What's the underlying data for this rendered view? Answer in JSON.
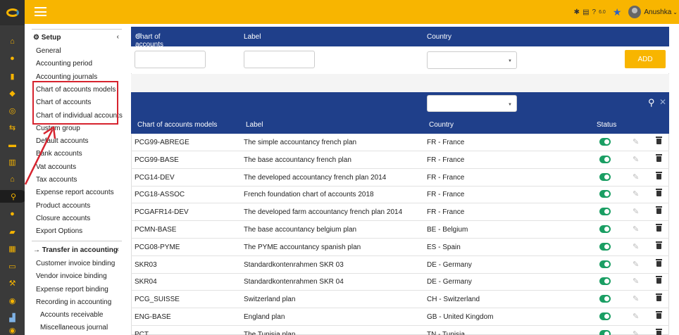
{
  "topbar": {
    "version": "6.0",
    "username": "Anushka"
  },
  "icons": {
    "rail": [
      "home-icon",
      "user-icon",
      "book-icon",
      "box-icon",
      "coins-icon",
      "flow-icon",
      "briefcase-icon",
      "stack-icon",
      "bank-icon",
      "search-icon",
      "person-icon",
      "folder-icon",
      "calendar-icon",
      "card-icon",
      "wrench-icon",
      "globe-icon",
      "chart-icon",
      "php-icon"
    ],
    "accent": "#f8b500",
    "header_blue": "#1f3f8a",
    "status_green": "#1a9e63",
    "highlight_red": "#d6232e"
  },
  "sidebar": {
    "setup_title": "Setup",
    "setup_items": [
      "General",
      "Accounting period",
      "Accounting journals",
      "Chart of accounts models",
      "Chart of accounts",
      "Chart of individual accounts",
      "Custom group",
      "Default accounts",
      "Bank accounts",
      "Vat accounts",
      "Tax accounts",
      "Expense report accounts",
      "Product accounts",
      "Closure accounts",
      "Export Options"
    ],
    "transfer_title": "Transfer in accounting",
    "transfer_items": [
      "Customer invoice binding",
      "Vendor invoice binding",
      "Expense report binding",
      "Recording in accounting"
    ],
    "recording_subitems": [
      "Accounts receivable",
      "Miscellaneous journal"
    ]
  },
  "form": {
    "col_model": "Chart of accounts models",
    "col_label": "Label",
    "col_country": "Country",
    "add_label": "ADD"
  },
  "table": {
    "headers": {
      "model": "Chart of accounts models",
      "label": "Label",
      "country": "Country",
      "status": "Status"
    },
    "rows": [
      {
        "model": "PCG99-ABREGE",
        "label": "The simple accountancy french plan",
        "country": "FR - France",
        "active": true
      },
      {
        "model": "PCG99-BASE",
        "label": "The base accountancy french plan",
        "country": "FR - France",
        "active": true
      },
      {
        "model": "PCG14-DEV",
        "label": "The developed accountancy french plan 2014",
        "country": "FR - France",
        "active": true
      },
      {
        "model": "PCG18-ASSOC",
        "label": "French foundation chart of accounts 2018",
        "country": "FR - France",
        "active": true
      },
      {
        "model": "PCGAFR14-DEV",
        "label": "The developed farm accountancy french plan 2014",
        "country": "FR - France",
        "active": true
      },
      {
        "model": "PCMN-BASE",
        "label": "The base accountancy belgium plan",
        "country": "BE - Belgium",
        "active": true
      },
      {
        "model": "PCG08-PYME",
        "label": "The PYME accountancy spanish plan",
        "country": "ES - Spain",
        "active": true
      },
      {
        "model": "SKR03",
        "label": "Standardkontenrahmen SKR 03",
        "country": "DE - Germany",
        "active": true
      },
      {
        "model": "SKR04",
        "label": "Standardkontenrahmen SKR 04",
        "country": "DE - Germany",
        "active": true
      },
      {
        "model": "PCG_SUISSE",
        "label": "Switzerland plan",
        "country": "CH - Switzerland",
        "active": true
      },
      {
        "model": "ENG-BASE",
        "label": "England plan",
        "country": "GB - United Kingdom",
        "active": true
      },
      {
        "model": "PCT",
        "label": "The Tunisia plan",
        "country": "TN - Tunisia",
        "active": true
      }
    ]
  }
}
